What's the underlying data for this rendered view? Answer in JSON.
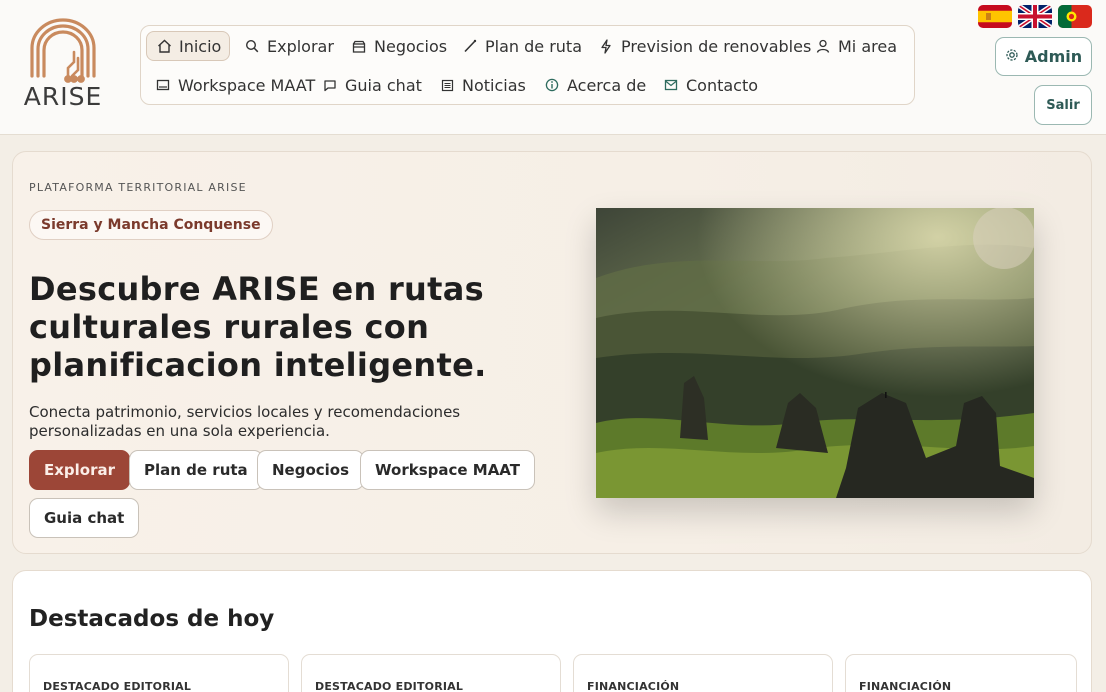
{
  "brand": {
    "name": "ARISE"
  },
  "nav": {
    "items": [
      {
        "label": "Inicio",
        "icon": "home-icon"
      },
      {
        "label": "Explorar",
        "icon": "search-icon"
      },
      {
        "label": "Negocios",
        "icon": "shop-icon"
      },
      {
        "label": "Plan de ruta",
        "icon": "route-icon"
      },
      {
        "label": "Prevision de renovables",
        "icon": "bolt-icon"
      },
      {
        "label": "Mi area",
        "icon": "user-icon"
      },
      {
        "label": "Workspace MAAT",
        "icon": "monitor-icon"
      },
      {
        "label": "Guia chat",
        "icon": "chat-icon"
      },
      {
        "label": "Noticias",
        "icon": "news-icon"
      },
      {
        "label": "Acerca de",
        "icon": "info-icon"
      },
      {
        "label": "Contacto",
        "icon": "mail-icon"
      }
    ],
    "active": "Inicio"
  },
  "languages": [
    "es",
    "en",
    "pt"
  ],
  "header": {
    "admin_label": "Admin",
    "logout_label": "Salir"
  },
  "hero": {
    "eyebrow": "PLATAFORMA TERRITORIAL ARISE",
    "pill": "Sierra y Mancha Conquense",
    "title": "Descubre ARISE en rutas culturales rurales con planificacion inteligente.",
    "description": "Conecta patrimonio, servicios locales y recomendaciones personalizadas en una sola experiencia.",
    "buttons": [
      "Explorar",
      "Plan de ruta",
      "Negocios",
      "Workspace MAAT",
      "Guia chat"
    ]
  },
  "highlights": {
    "title": "Destacados de hoy",
    "cards": [
      {
        "tag": "DESTACADO EDITORIAL"
      },
      {
        "tag": "DESTACADO EDITORIAL"
      },
      {
        "tag": "FINANCIACIÓN"
      },
      {
        "tag": "FINANCIACIÓN"
      }
    ]
  },
  "colors": {
    "accent": "#9c4637",
    "teal": "#2e5a56",
    "logo": "#c98a5e"
  }
}
